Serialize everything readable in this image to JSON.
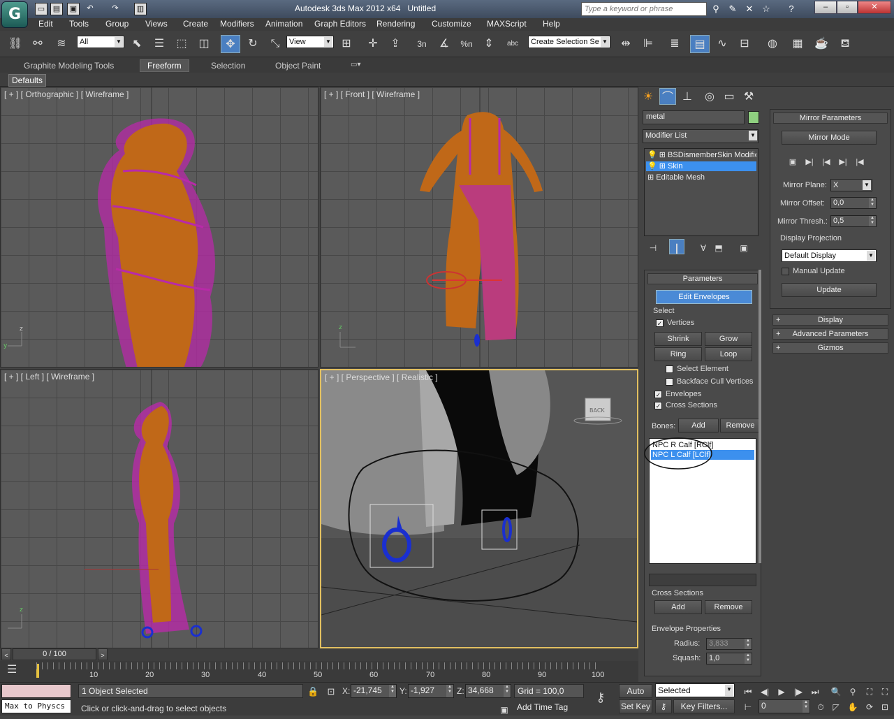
{
  "app": {
    "logo": "G",
    "title": "Autodesk 3ds Max  2012 x64",
    "document": "Untitled"
  },
  "search": {
    "placeholder": "Type a keyword or phrase"
  },
  "menu": [
    "Edit",
    "Tools",
    "Group",
    "Views",
    "Create",
    "Modifiers",
    "Animation",
    "Graph Editors",
    "Rendering",
    "Customize",
    "MAXScript",
    "Help"
  ],
  "toolbar": {
    "filter": "All",
    "coord": "View",
    "selection_set": "Create Selection Se",
    "snap_labels": [
      "3n",
      "%n"
    ]
  },
  "ribbon": {
    "tabs": [
      "Graphite Modeling Tools",
      "Freeform",
      "Selection",
      "Object Paint"
    ],
    "active": "Freeform",
    "defaults": "Defaults"
  },
  "viewports": {
    "top_left": "[ + ] [ Orthographic ] [ Wireframe ]",
    "top_right": "[ + ] [ Front ] [ Wireframe ]",
    "bottom_left": "[ + ] [ Left ] [ Wireframe ]",
    "bottom_right": "[ + ] [ Perspective ] [ Realistic ]",
    "viewcube": "BACK"
  },
  "command_panel": {
    "object_name": "metal",
    "modifier_list": "Modifier List",
    "stack": [
      "BSDismemberSkin Modifie",
      "Skin",
      "Editable Mesh"
    ],
    "selected_stack": "Skin"
  },
  "parameters": {
    "title": "Parameters",
    "edit_envelopes": "Edit Envelopes",
    "select_group": "Select",
    "vertices": "Vertices",
    "shrink": "Shrink",
    "grow": "Grow",
    "ring": "Ring",
    "loop": "Loop",
    "select_element": "Select Element",
    "backface": "Backface Cull Vertices",
    "envelopes": "Envelopes",
    "cross_sections": "Cross Sections",
    "bones_label": "Bones:",
    "add": "Add",
    "remove": "Remove",
    "bones": [
      "NPC R Calf [RClf]",
      "NPC L Calf [LClf]"
    ],
    "selected_bone": "NPC L Calf [LClf]",
    "cs_group": "Cross Sections",
    "cs_add": "Add",
    "cs_remove": "Remove",
    "env_props": "Envelope Properties",
    "radius_label": "Radius:",
    "radius": "3,833",
    "squash_label": "Squash:",
    "squash": "1,0"
  },
  "mirror": {
    "title": "Mirror Parameters",
    "mode": "Mirror Mode",
    "plane_label": "Mirror Plane:",
    "plane": "X",
    "offset_label": "Mirror Offset:",
    "offset": "0,0",
    "thresh_label": "Mirror Thresh.:",
    "thresh": "0,5",
    "projection_label": "Display Projection",
    "projection": "Default Display",
    "manual_update": "Manual Update",
    "update": "Update",
    "rollouts": [
      "Display",
      "Advanced Parameters",
      "Gizmos"
    ]
  },
  "timeline": {
    "frame": "0 / 100",
    "ticks": [
      "10",
      "20",
      "30",
      "40",
      "50",
      "60",
      "70",
      "80",
      "90",
      "100"
    ]
  },
  "status": {
    "maxscript": "Max to Physcs",
    "selection": "1 Object Selected",
    "prompt": "Click or click-and-drag to select objects",
    "x_label": "X:",
    "x": "-21,745",
    "y_label": "Y:",
    "y": "-1,927",
    "z_label": "Z:",
    "z": "34,668",
    "grid": "Grid = 100,0",
    "add_time_tag": "Add Time Tag",
    "auto_key": "Auto Key",
    "set_key": "Set Key",
    "selected": "Selected",
    "key_filters": "Key Filters...",
    "frame_field": "0"
  },
  "colors": {
    "accent": "#4a8ad6",
    "mesh": "#c06818",
    "wire": "#b82aa8",
    "bone": "#1a2fd0",
    "object_color": "#8fd080"
  }
}
